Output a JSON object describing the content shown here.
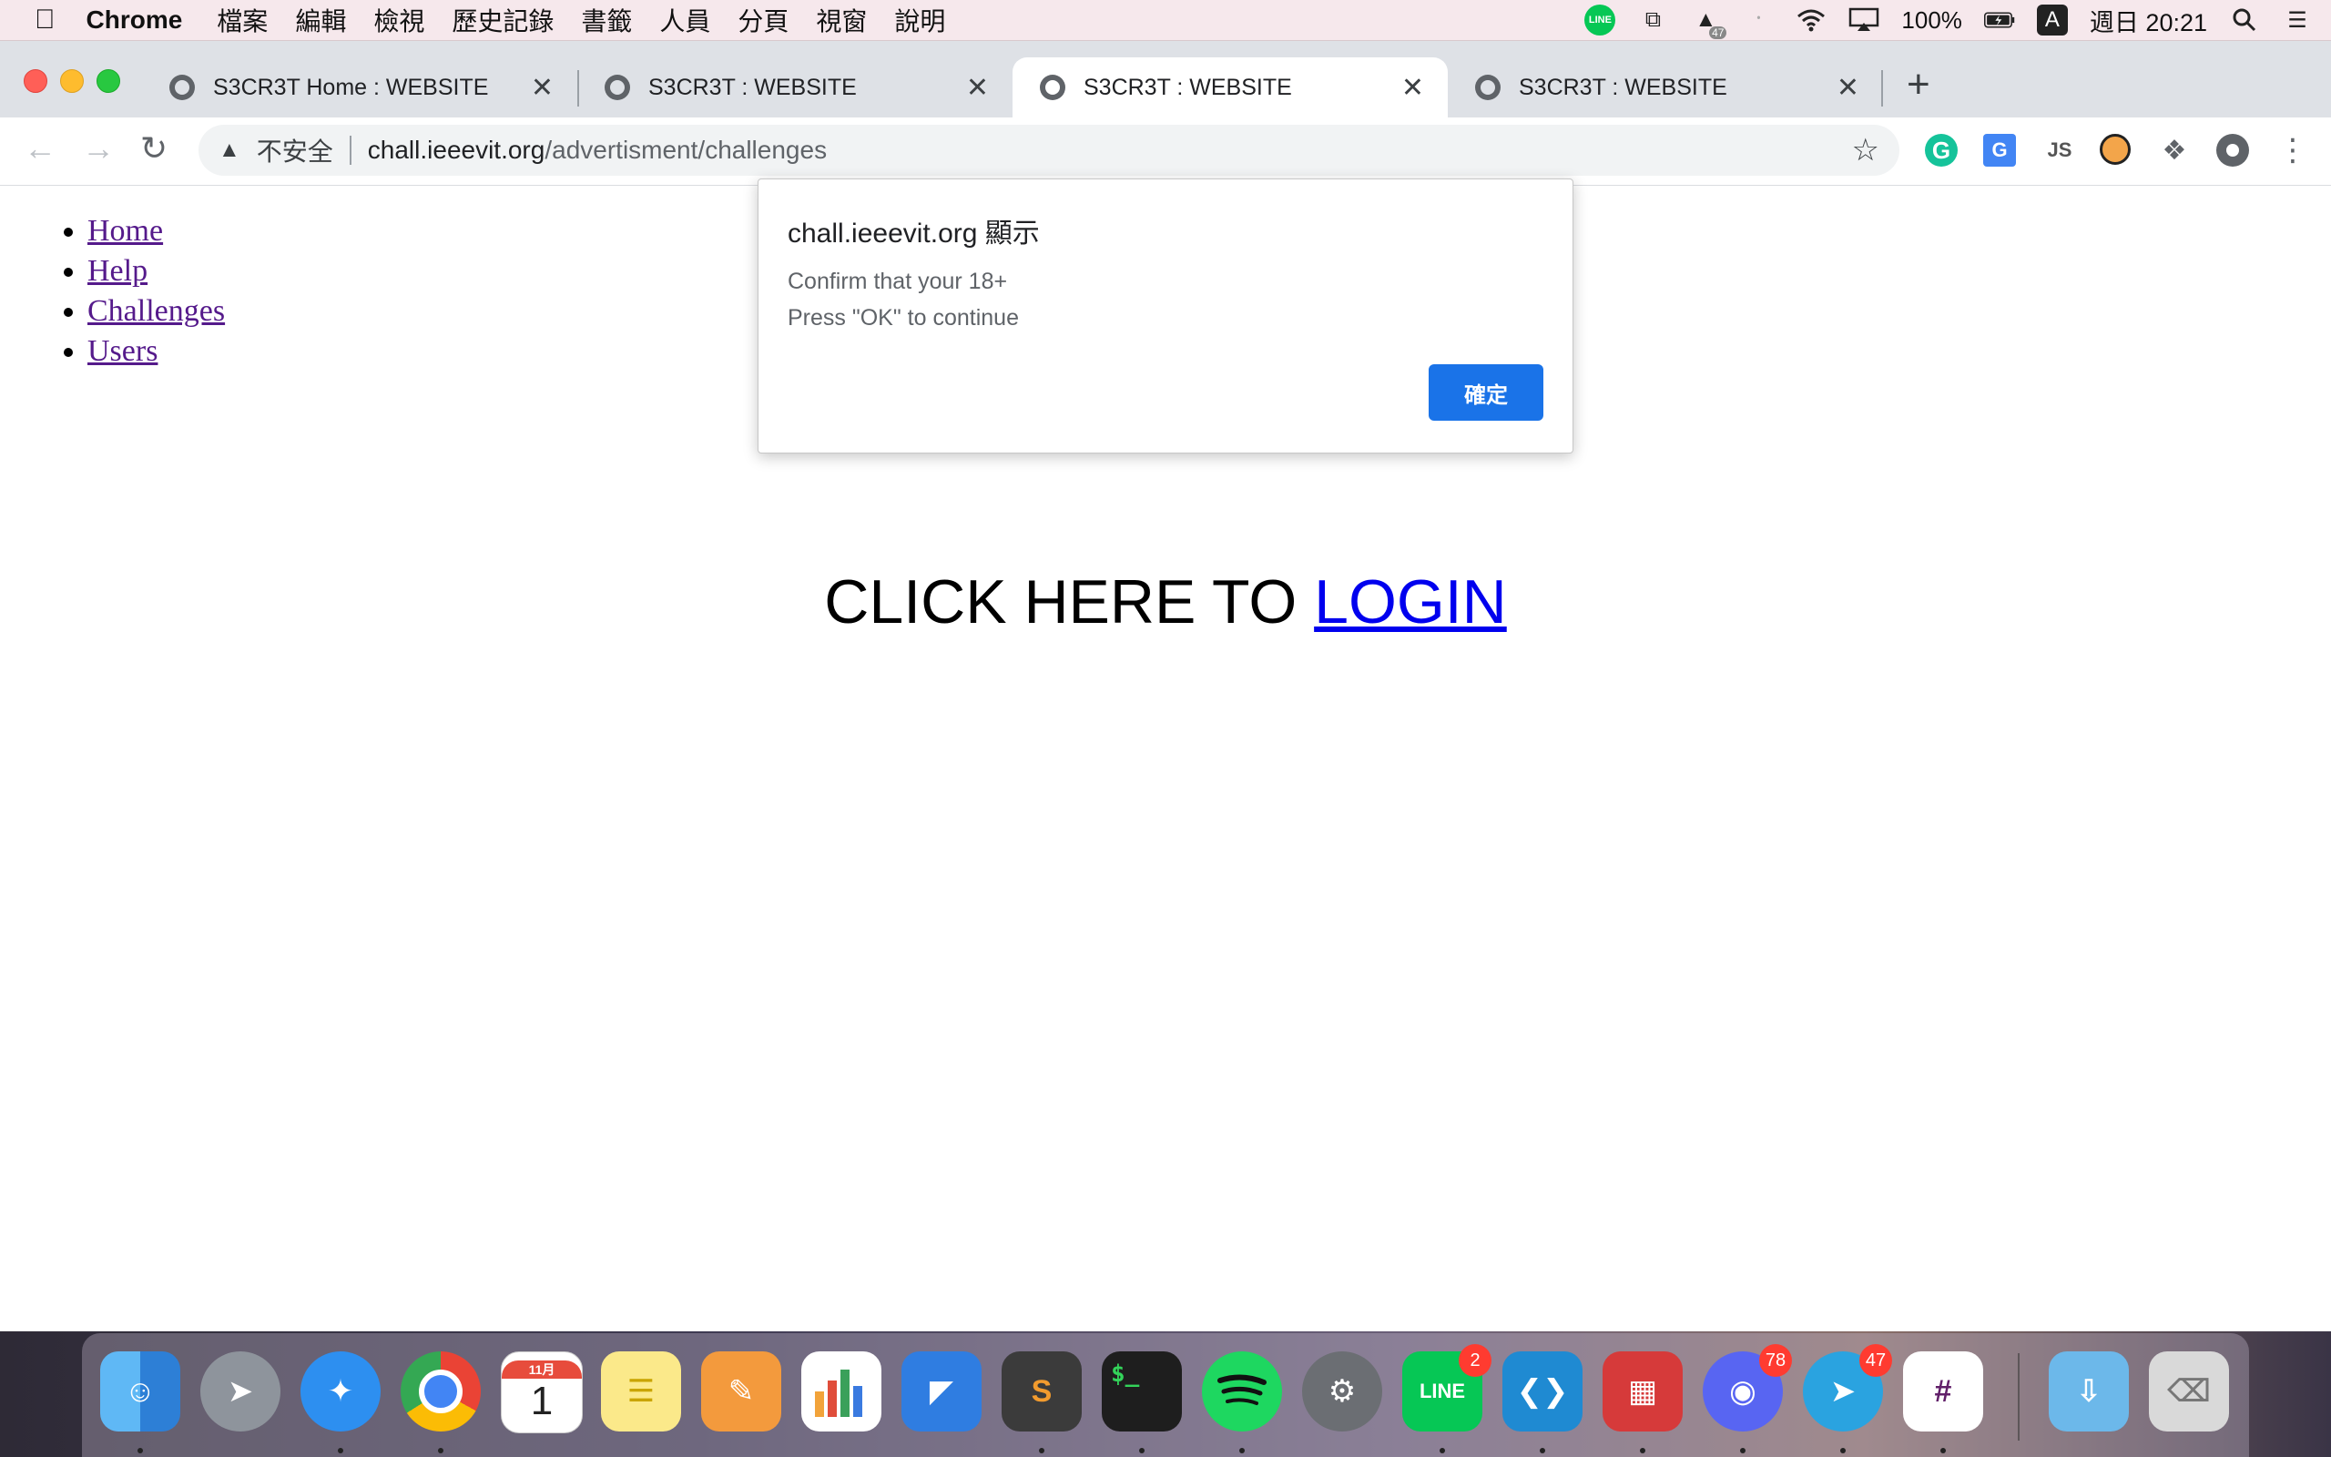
{
  "menubar": {
    "apple_icon": "apple-icon",
    "app_name": "Chrome",
    "menus": [
      "檔案",
      "編輯",
      "檢視",
      "歷史記錄",
      "書籤",
      "人員",
      "分頁",
      "視窗",
      "說明"
    ],
    "tray": {
      "line_label": "LINE",
      "badge_47": "47",
      "battery": "100%",
      "input_source": "A",
      "clock": "週日 20:21"
    }
  },
  "tabs": [
    {
      "title": "S3CR3T Home : WEBSITE",
      "active": false
    },
    {
      "title": "S3CR3T : WEBSITE",
      "active": false
    },
    {
      "title": "S3CR3T : WEBSITE",
      "active": true
    },
    {
      "title": "S3CR3T : WEBSITE",
      "active": false
    }
  ],
  "omnibox": {
    "security_label": "不安全",
    "host": "chall.ieeevit.org",
    "path": "/advertisment/challenges"
  },
  "page": {
    "nav": [
      "Home",
      "Help",
      "Challenges",
      "Users"
    ],
    "cta_prefix": "CLICK HERE TO ",
    "cta_link": "LOGIN"
  },
  "dialog": {
    "origin": "chall.ieeevit.org 顯示",
    "line1": "Confirm that your 18+",
    "line2": "Press \"OK\" to continue",
    "ok_label": "確定"
  },
  "dock": {
    "calendar_month": "11月",
    "calendar_day": "1",
    "line_badge": "2",
    "discord_badge": "78",
    "telegram_badge": "47",
    "line_label": "LINE"
  },
  "colors": {
    "accent_blue": "#1a73e8",
    "link_visited": "#551a8b",
    "link": "#0000ee"
  }
}
